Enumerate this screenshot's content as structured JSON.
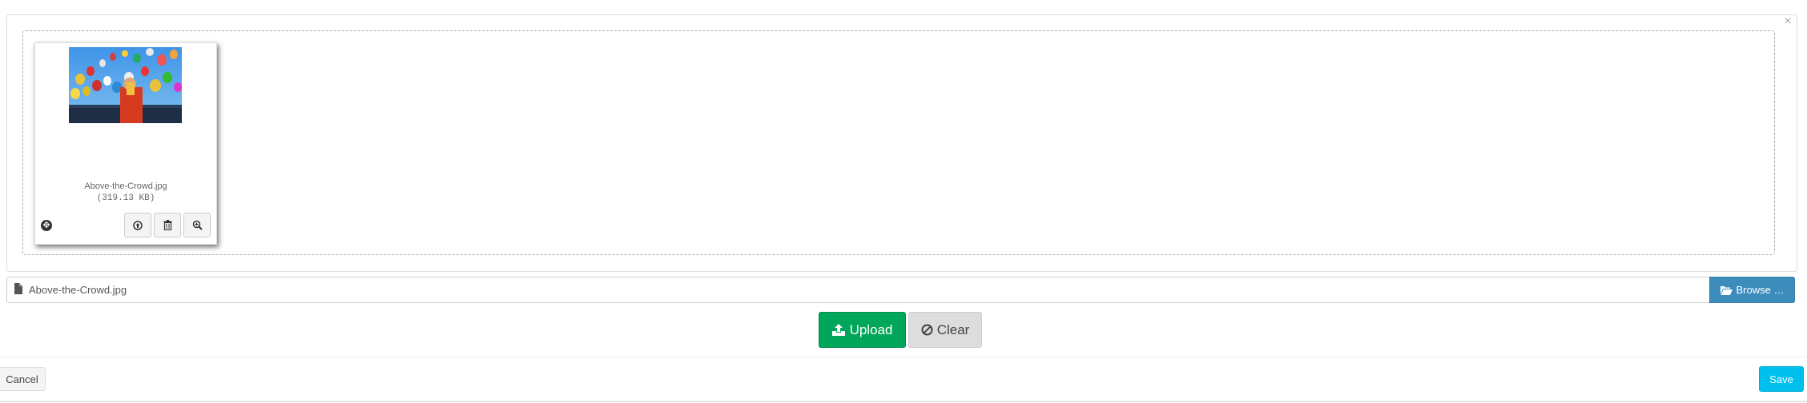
{
  "file_input": {
    "close_symbol": "×",
    "preview": {
      "file_name": "Above-the-Crowd.jpg",
      "file_size": "(319.13 KB)",
      "image_description": "hot air balloons in a blue sky above a crowd",
      "drag_icon": "move-icon",
      "actions": [
        {
          "name": "upload-file",
          "icon": "upload-circle-icon"
        },
        {
          "name": "delete-file",
          "icon": "trash-icon"
        },
        {
          "name": "zoom-file",
          "icon": "zoom-in-icon"
        }
      ]
    },
    "caption": {
      "value": "Above-the-Crowd.jpg",
      "icon": "file-icon"
    },
    "browse_label": "Browse …",
    "upload_label": "Upload",
    "clear_label": "Clear"
  },
  "footer": {
    "cancel_label": "Cancel",
    "save_label": "Save"
  },
  "colors": {
    "upload": "#00a65a",
    "browse": "#3c8dbc",
    "save": "#00c0ef",
    "clear": "#dddddd"
  }
}
